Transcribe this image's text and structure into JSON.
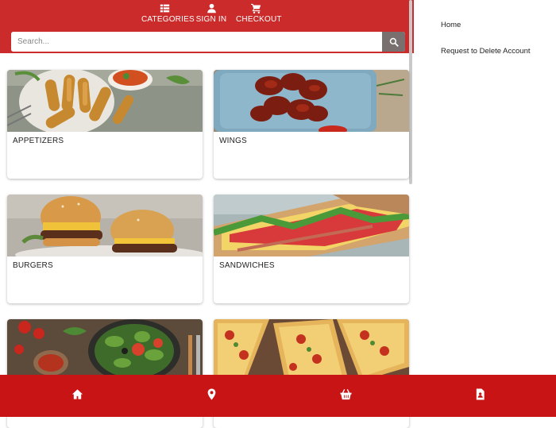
{
  "nav": {
    "categories_label": "CATEGORIES",
    "signin_label": "SIGN IN",
    "checkout_label": "CHECKOUT"
  },
  "search": {
    "placeholder": "Search..."
  },
  "categories": [
    {
      "label": "APPETIZERS"
    },
    {
      "label": "WINGS"
    },
    {
      "label": "BURGERS"
    },
    {
      "label": "SANDWICHES"
    },
    {
      "label": ""
    },
    {
      "label": ""
    }
  ],
  "sidebar": {
    "home_label": "Home",
    "delete_account_label": "Request to Delete Account"
  },
  "bottom_nav": [
    "home-icon",
    "location-icon",
    "basket-icon",
    "contact-icon"
  ],
  "colors": {
    "brand": "#cc2b2b",
    "bottom_bar": "#c81414",
    "search_button": "#7a6f6f"
  }
}
